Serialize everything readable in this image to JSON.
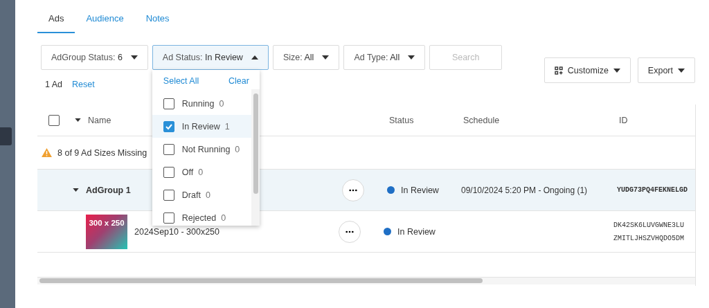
{
  "tabs": [
    {
      "label": "Ads",
      "selected": true
    },
    {
      "label": "Audience",
      "selected": false
    },
    {
      "label": "Notes",
      "selected": false
    }
  ],
  "filters": [
    {
      "label": "AdGroup Status: ",
      "value": "6",
      "open": false
    },
    {
      "label": "Ad Status: ",
      "value": "In Review",
      "open": true
    },
    {
      "label": "Size: ",
      "value": "All",
      "open": false
    },
    {
      "label": "Ad Type: ",
      "value": "All",
      "open": false
    }
  ],
  "search": {
    "placeholder": "Search"
  },
  "customize_button": "Customize",
  "export_button": "Export",
  "result_count": "1 Ad",
  "reset_link": "Reset",
  "dropdown": {
    "select_all": "Select All",
    "clear": "Clear",
    "options": [
      {
        "label": "Running",
        "count": "0",
        "checked": false
      },
      {
        "label": "In Review",
        "count": "1",
        "checked": true
      },
      {
        "label": "Not Running",
        "count": "0",
        "checked": false
      },
      {
        "label": "Off",
        "count": "0",
        "checked": false
      },
      {
        "label": "Draft",
        "count": "0",
        "checked": false
      },
      {
        "label": "Rejected",
        "count": "0",
        "checked": false
      }
    ]
  },
  "table": {
    "columns": [
      "Name",
      "Status",
      "Schedule",
      "ID"
    ],
    "select_all_checked": false,
    "warning": "8 of 9 Ad Sizes Missing",
    "rows": [
      {
        "kind": "group",
        "name": "AdGroup 1",
        "status": "In Review",
        "schedule": "09/10/2024 5:20 PM - Ongoing (1)",
        "ids": [
          "YUDG73PQ4FEKNELGD"
        ]
      },
      {
        "kind": "ad",
        "thumbnail": "300 x 250",
        "name": "2024Sep10 - 300x250",
        "status": "In Review",
        "ids": [
          "DK42SK6LUVGWNE3LU",
          "ZMITLJHSZVHQDO5DM"
        ]
      }
    ]
  }
}
